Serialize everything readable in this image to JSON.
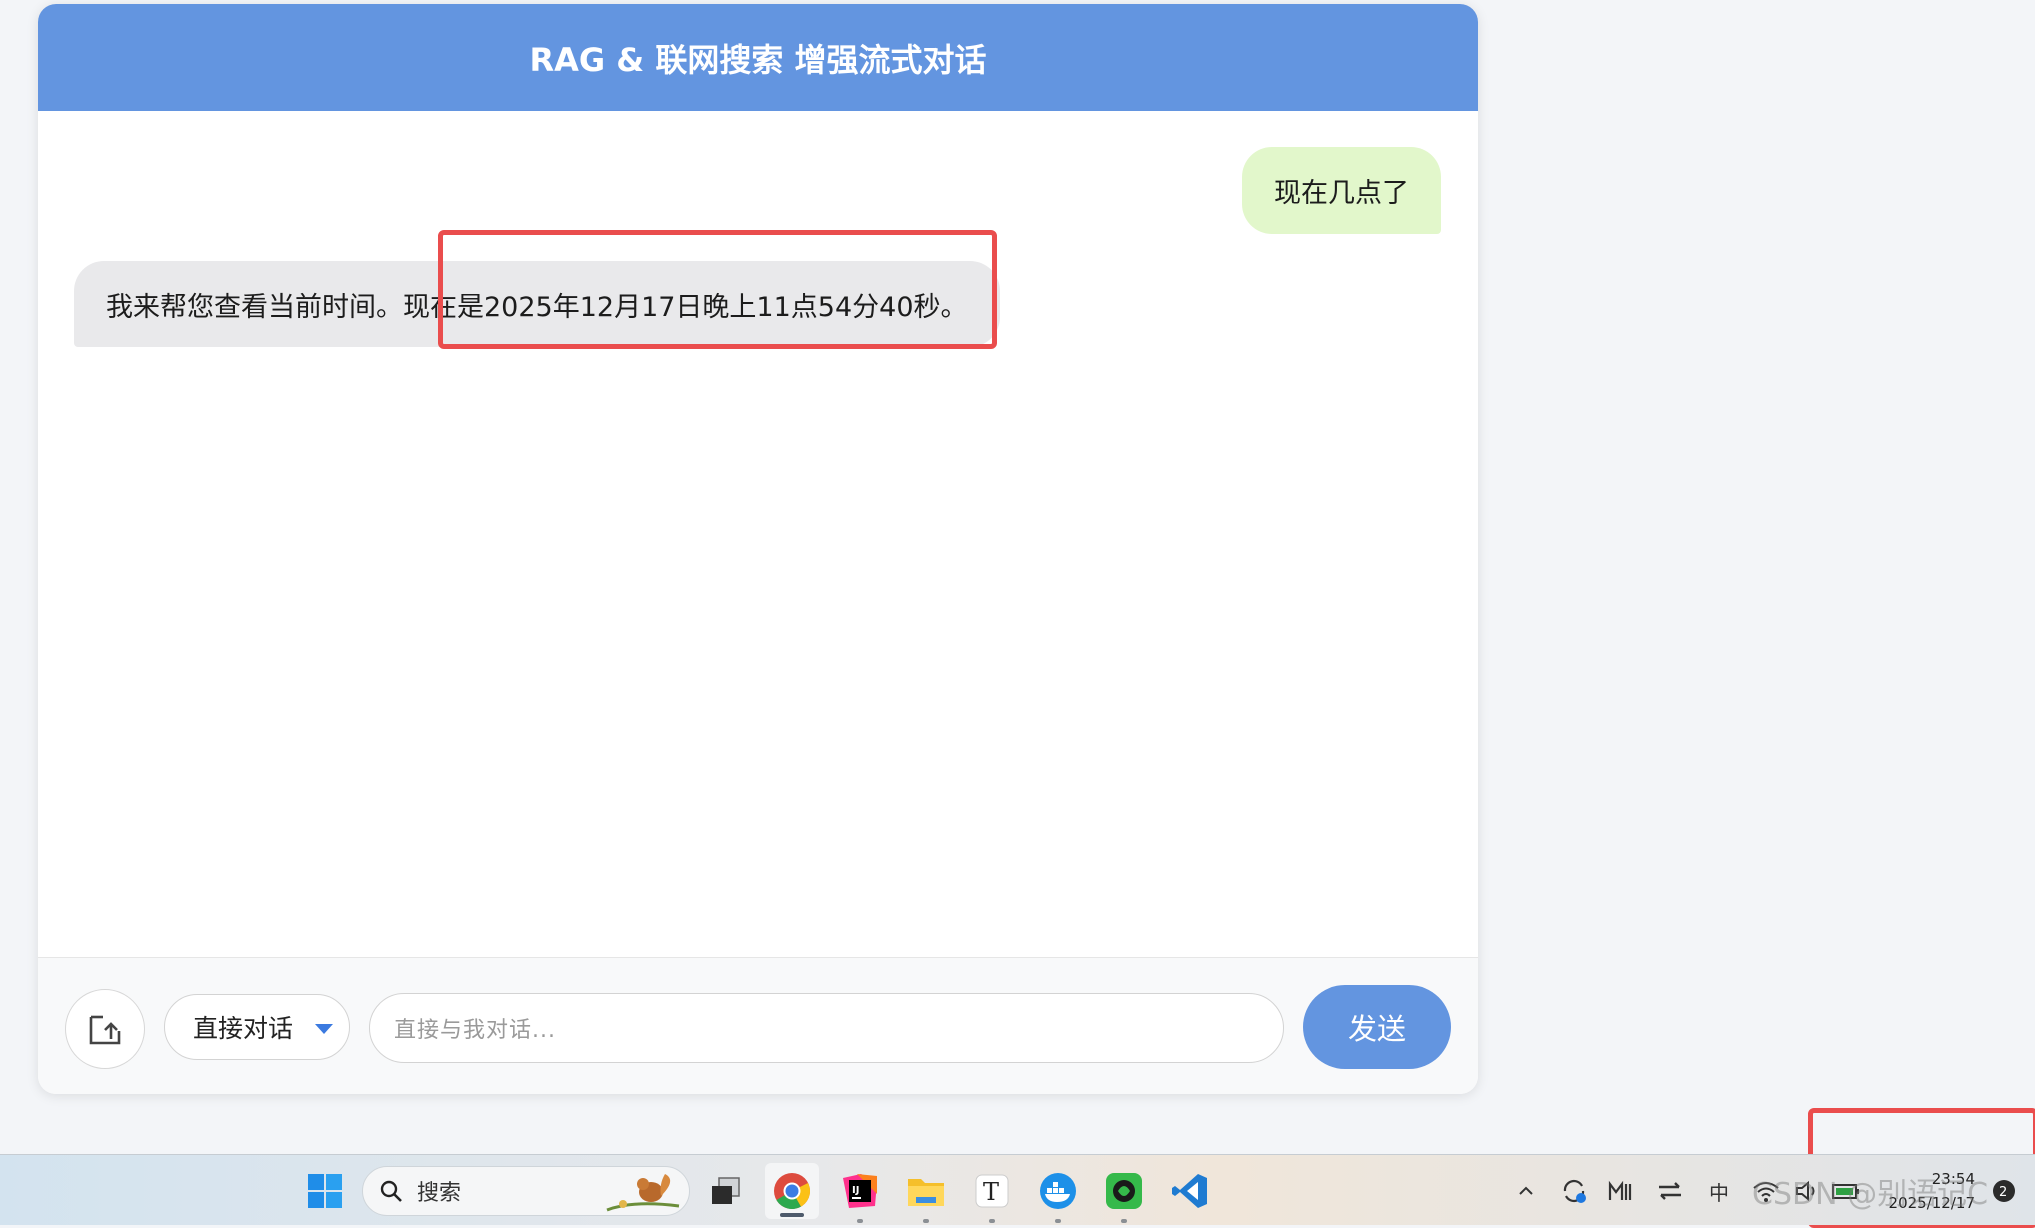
{
  "app": {
    "title": "RAG & 联网搜索 增强流式对话"
  },
  "messages": [
    {
      "role": "user",
      "text": "现在几点了"
    },
    {
      "role": "assistant",
      "text": "我来帮您查看当前时间。现在是2025年12月17日晚上11点54分40秒。"
    }
  ],
  "footer": {
    "upload_icon": "upload-icon",
    "mode_selected": "直接对话",
    "input_placeholder": "直接与我对话...",
    "send_label": "发送"
  },
  "taskbar": {
    "search_label": "搜索",
    "apps": [
      "windows-start-icon",
      "task-view-icon",
      "chrome-icon",
      "intellij-icon",
      "file-explorer-icon",
      "typora-icon",
      "docker-icon",
      "app-icon",
      "vscode-icon"
    ],
    "tray": {
      "ime": "中",
      "time": "23:54",
      "date": "2025/12/17"
    }
  },
  "watermark": "CSDN @别语记C",
  "colors": {
    "header": "#6395e0",
    "user_bubble": "#e2f7cb",
    "bot_bubble": "#e9e9eb",
    "highlight": "#ea4d4d",
    "send": "#6395e0"
  }
}
